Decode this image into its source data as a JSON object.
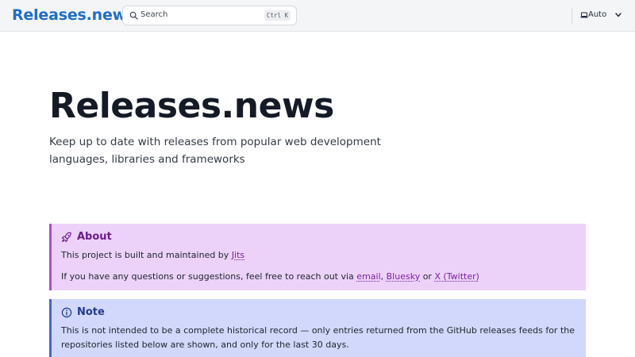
{
  "header": {
    "brand": "Releases.news",
    "search_placeholder": "Search",
    "search_shortcut": "Ctrl K",
    "theme_label": "Auto"
  },
  "hero": {
    "title": "Releases.news",
    "subtitle": "Keep up to date with releases from popular web development languages, libraries and frameworks"
  },
  "about": {
    "title": "About",
    "line1_prefix": "This project is built and maintained by ",
    "author_link": "Jits",
    "line2_prefix": "If you have any questions or suggestions, feel free to reach out via ",
    "email_link": "email",
    "sep1": ", ",
    "bluesky_link": "Bluesky",
    "sep2": " or ",
    "x_link": "X (Twitter)"
  },
  "note": {
    "title": "Note",
    "text": "This is not intended to be a complete historical record — only entries returned from the GitHub releases feeds for the repositories listed below are shown, and only for the last 30 days."
  },
  "colors": {
    "brand": "#1f6fc5",
    "about_bg": "#ecd2f9",
    "about_border": "#b14ad9",
    "note_bg": "#d1d8fb",
    "note_border": "#4865d6"
  },
  "icons": {
    "search": "search-icon",
    "theme": "laptop-icon",
    "chevron": "chevron-down-icon",
    "about": "rocket-icon",
    "note": "info-icon"
  }
}
